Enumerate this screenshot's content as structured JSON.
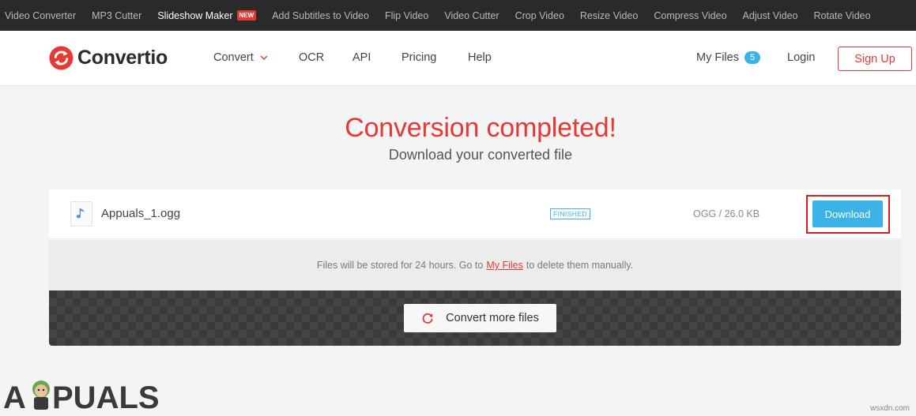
{
  "topbar": {
    "tools": [
      {
        "label": "Video Converter"
      },
      {
        "label": "MP3 Cutter"
      },
      {
        "label": "Slideshow Maker",
        "badge": "NEW"
      },
      {
        "label": "Add Subtitles to Video"
      },
      {
        "label": "Flip Video"
      },
      {
        "label": "Video Cutter"
      },
      {
        "label": "Crop Video"
      },
      {
        "label": "Resize Video"
      },
      {
        "label": "Compress Video"
      },
      {
        "label": "Adjust Video"
      },
      {
        "label": "Rotate Video"
      }
    ]
  },
  "nav": {
    "logo_text": "Convertio",
    "convert": "Convert",
    "ocr": "OCR",
    "api": "API",
    "pricing": "Pricing",
    "help": "Help",
    "my_files": "My Files",
    "my_files_count": "5",
    "login": "Login",
    "signup": "Sign Up"
  },
  "main": {
    "heading": "Conversion completed!",
    "subheading": "Download your converted file",
    "file": {
      "name": "Appuals_1.ogg",
      "status": "FINISHED",
      "size": "OGG / 26.0 KB",
      "download": "Download"
    },
    "storage_note": {
      "before": "Files will be stored for 24 hours. Go to",
      "link": "My Files",
      "after": "to delete them manually."
    },
    "convert_more": "Convert more files"
  },
  "watermark": {
    "text": "APPUALS"
  },
  "site_mark": "wsxdn.com",
  "colors": {
    "accent_red": "#e53935",
    "accent_blue": "#3bb3e6",
    "topbar_bg": "#2a2a2a"
  },
  "icons": {
    "logo": "convertio-logo-icon",
    "file": "music-note-icon",
    "convert_more": "refresh-icon",
    "convert_dropdown": "chevron-down-icon"
  }
}
